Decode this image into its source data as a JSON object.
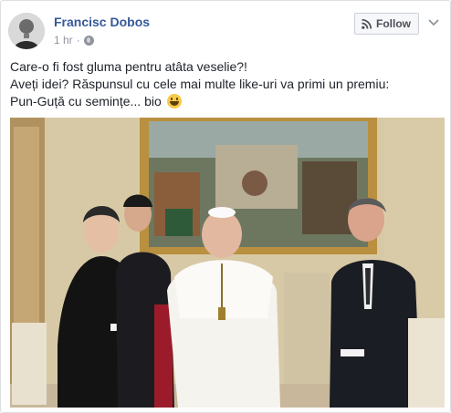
{
  "post": {
    "author": "Francisc Dobos",
    "time": "1 hr",
    "separator": "·",
    "privacy_icon": "globe-icon",
    "follow_label": "Follow",
    "follow_icon": "rss-icon",
    "more_icon": "chevron-down-icon",
    "text_lines": [
      "Care-o fi fost gluma pentru atâta veselie?!",
      "Aveți idei? Răspunsul cu cele mai multe like-uri va primi un premiu:",
      "Pun-Guță cu semințe... bio"
    ],
    "emoji": "grinning-face-icon",
    "photo": "group-photo",
    "colors": {
      "author_link": "#365899",
      "meta_gray": "#90949c",
      "follow_bg": "#f6f7f9"
    }
  }
}
